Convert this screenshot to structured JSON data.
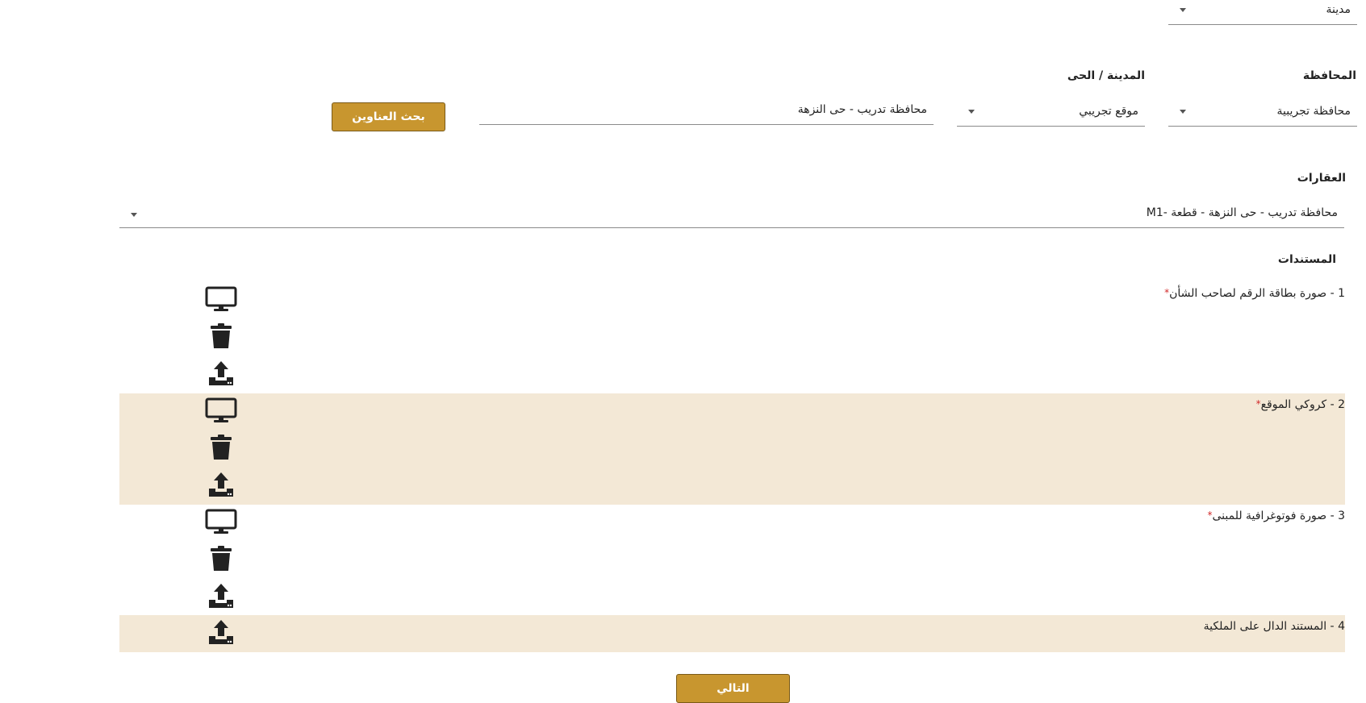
{
  "top_select": {
    "value": "مدينة"
  },
  "location": {
    "governorate_label": "المحافظة",
    "governorate_value": "محافظة تجريبية",
    "city_label": "المدينة / الحى",
    "city_value": "موقع تجريبي",
    "address_value": "محافظة تدريب - حى النزهة",
    "search_button": "بحث العناوين"
  },
  "properties": {
    "label": "العقارات",
    "value": "محافظة تدريب - حى النزهة - قطعة -M1"
  },
  "documents": {
    "label": "المستندات",
    "required_mark": "*",
    "items": [
      {
        "title": "1 - صورة بطاقة الرقم لصاحب الشأن",
        "required": true,
        "icons": [
          "monitor-icon",
          "trash-icon",
          "upload-icon"
        ]
      },
      {
        "title": "2 - كروكي الموقع",
        "required": true,
        "icons": [
          "monitor-icon",
          "trash-icon",
          "upload-icon"
        ]
      },
      {
        "title": "3 - صورة فوتوغرافية للمبنى",
        "required": true,
        "icons": [
          "monitor-icon",
          "trash-icon",
          "upload-icon"
        ]
      },
      {
        "title": "4 - المستند الدال على الملكية",
        "required": false,
        "icons": [
          "upload-icon"
        ]
      }
    ]
  },
  "next_button": "التالي",
  "colors": {
    "accent": "#c8962f",
    "band": "#f3e8d6",
    "required": "#d12a2a"
  }
}
